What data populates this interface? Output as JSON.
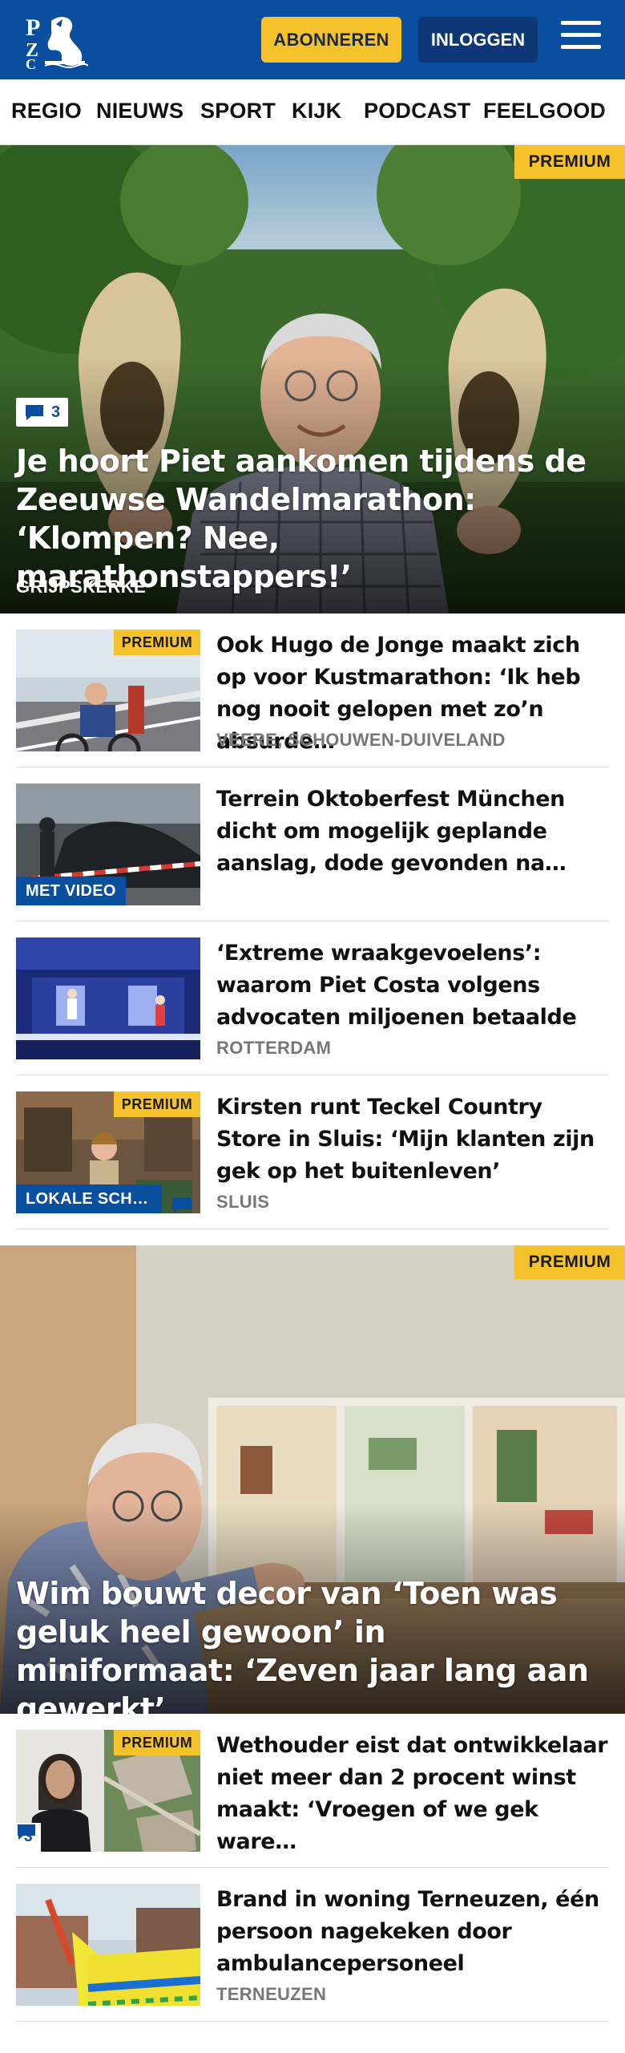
{
  "header": {
    "logo_text": "PZC",
    "subscribe_label": "ABONNEREN",
    "login_label": "INLOGGEN"
  },
  "nav": {
    "items": [
      "REGIO",
      "NIEUWS",
      "SPORT",
      "KIJK",
      "PODCAST",
      "FEELGOOD"
    ]
  },
  "hero1": {
    "badge": "PREMIUM",
    "comment_count": "3",
    "title": "Je hoort Piet aankomen tijdens de Zeeuwse Wandelmarathon: ‘Klompen? Nee, marathonstappers!’",
    "location": "GRIJPSKERKE"
  },
  "articles": [
    {
      "badge": "PREMIUM",
      "title": "Ook Hugo de Jonge maakt zich op voor Kustmarathon: ‘Ik heb nog nooit gelopen met zo’n absurde…",
      "location": "VEERE, SCHOUWEN-DUIVELAND"
    },
    {
      "label": "MET VIDEO",
      "title": "Terrein Oktoberfest München dicht om mogelijk geplande aanslag, dode gevonden na…"
    },
    {
      "title": "‘Extreme wraakgevoelens’: waarom Piet Costa volgens advocaten miljoenen betaalde",
      "location": "ROTTERDAM"
    },
    {
      "badge": "PREMIUM",
      "label": "LOKALE SCH…",
      "title": "Kirsten runt Teckel Country Store in Sluis: ‘Mijn klanten zijn gek op het buitenleven’",
      "location": "SLUIS"
    }
  ],
  "hero2": {
    "badge": "PREMIUM",
    "title": "Wim bouwt decor van ‘Toen was geluk heel gewoon’ in miniformaat: ‘Zeven jaar lang aan gewerkt’"
  },
  "articles2": [
    {
      "badge": "PREMIUM",
      "comment_count": "3",
      "title": "Wethouder eist dat ontwikkelaar niet meer dan 2 procent winst maakt: ‘Vroegen of we gek ware…"
    },
    {
      "title": "Brand in woning Terneuzen, één persoon nagekeken door ambulancepersoneel",
      "location": "TERNEUZEN"
    }
  ],
  "colors": {
    "brand_blue": "#0a4ea0",
    "premium_yellow": "#f5c22c",
    "login_navy": "#0d3776"
  },
  "icons": [
    "pzc-logo-icon",
    "hamburger-menu-icon",
    "comment-icon"
  ]
}
